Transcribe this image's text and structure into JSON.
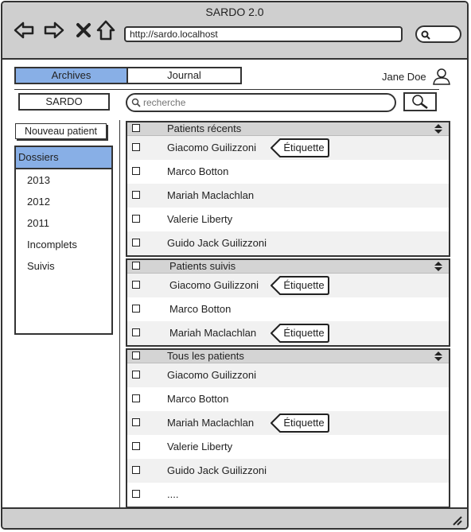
{
  "window": {
    "title": "SARDO 2.0"
  },
  "browser": {
    "url": "http://sardo.localhost",
    "nav_icons": [
      "back-arrow-icon",
      "forward-arrow-icon",
      "stop-icon",
      "home-icon"
    ]
  },
  "tabs": [
    {
      "label": "Archives",
      "active": true
    },
    {
      "label": "Journal",
      "active": false
    }
  ],
  "user": {
    "name": "Jane Doe"
  },
  "toolbar": {
    "app_button": "SARDO",
    "search_placeholder": "recherche"
  },
  "sidebar": {
    "new_patient_label": "Nouveau patient",
    "section_label": "Dossiers",
    "items": [
      "2013",
      "2012",
      "2011",
      "Incomplets",
      "Suivis"
    ]
  },
  "panels": [
    {
      "title": "Patients récents",
      "rows": [
        {
          "name": "Giacomo Guilizzoni",
          "tag": "Étiquette"
        },
        {
          "name": "Marco Botton",
          "tag": ""
        },
        {
          "name": "Mariah Maclachlan",
          "tag": ""
        },
        {
          "name": "Valerie Liberty",
          "tag": ""
        },
        {
          "name": "Guido Jack Guilizzoni",
          "tag": ""
        }
      ]
    },
    {
      "title": "Patients suivis",
      "rows": [
        {
          "name": "Giacomo Guilizzoni",
          "tag": "Étiquette"
        },
        {
          "name": "Marco Botton",
          "tag": ""
        },
        {
          "name": "Mariah Maclachlan",
          "tag": "Étiquette"
        }
      ]
    },
    {
      "title": "Tous les patients",
      "rows": [
        {
          "name": "Giacomo Guilizzoni",
          "tag": ""
        },
        {
          "name": "Marco Botton",
          "tag": ""
        },
        {
          "name": "Mariah Maclachlan",
          "tag": "Étiquette"
        },
        {
          "name": "Valerie Liberty",
          "tag": ""
        },
        {
          "name": "Guido Jack Guilizzoni",
          "tag": ""
        },
        {
          "name": "....",
          "tag": ""
        }
      ]
    }
  ]
}
